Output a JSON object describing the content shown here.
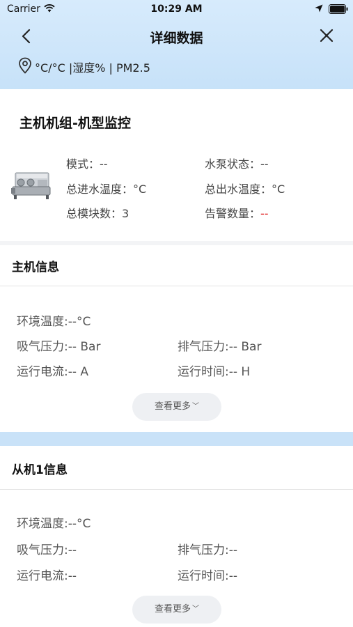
{
  "status_bar": {
    "carrier": "Carrier",
    "time": "10:29 AM",
    "icons": [
      "wifi-icon",
      "location-arrow-icon",
      "battery-icon"
    ]
  },
  "nav": {
    "title": "详细数据",
    "back_icon": "back-chevron-icon",
    "close_icon": "close-icon"
  },
  "weather": {
    "icon": "location-pin-icon",
    "text": "°C/°C |湿度% | PM2.5"
  },
  "unit_card": {
    "title": "主机机组-机型监控",
    "image_icon": "chiller-unit-image",
    "fields": {
      "mode": "模式：--",
      "pump_status": "水泵状态：--",
      "inlet_temp": "总进水温度：°C",
      "outlet_temp": "总出水温度：°C",
      "module_count": "总模块数：3",
      "alarm_label": "告警数量：",
      "alarm_value": "--"
    }
  },
  "host_section": {
    "title": "主机信息",
    "fields": {
      "ambient_temp": "环境温度:--°C",
      "suction_pressure": "吸气压力:-- Bar",
      "discharge_pressure": "排气压力:-- Bar",
      "run_current": "运行电流:-- A",
      "run_time": "运行时间:-- H"
    },
    "more_label": "查看更多"
  },
  "slave_section": {
    "title": "从机1信息",
    "fields": {
      "ambient_temp": "环境温度:--°C",
      "suction_pressure": "吸气压力:--",
      "discharge_pressure": "排气压力:--",
      "run_current": "运行电流:--",
      "run_time": "运行时间:--"
    },
    "more_label": "查看更多"
  },
  "colors": {
    "header_bg": "#cfe6fb",
    "alarm": "#e02020",
    "accent_strip": "#c9e2f8"
  }
}
